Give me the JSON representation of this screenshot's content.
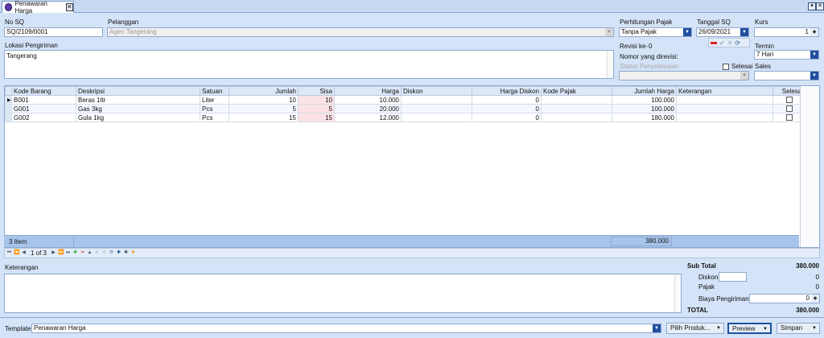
{
  "tab": {
    "title": "Penawaran Harga"
  },
  "header": {
    "no_sq": {
      "label": "No SQ",
      "value": "SQ/2109/0001"
    },
    "pelanggan": {
      "label": "Pelanggan",
      "placeholder": "Agen Tangerang"
    },
    "perhitungan_pajak": {
      "label": "Perhitungan Pajak",
      "value": "Tanpa Pajak"
    },
    "tanggal_sq": {
      "label": "Tanggal SQ",
      "value": "26/09/2021"
    },
    "kurs": {
      "label": "Kurs",
      "value": "1"
    },
    "lokasi": {
      "label": "Lokasi Pengiriman",
      "value": "Tangerang"
    },
    "revisi": {
      "label": "Revisi ke-",
      "value": "0"
    },
    "nomor_direvisi": {
      "label": "Nomor yang direvisi:"
    },
    "status_penyelesaian": {
      "label": "Status Penyelesaian"
    },
    "selesai": {
      "label": "Selesai"
    },
    "termin": {
      "label": "Termin",
      "value": "7 Hari"
    },
    "sales": {
      "label": "Sales",
      "value": ""
    }
  },
  "grid": {
    "columns": [
      "Kode Barang",
      "Deskripsi",
      "Satuan",
      "Jumlah",
      "Sisa",
      "Harga",
      "Diskon",
      "Harga Diskon",
      "Kode Pajak",
      "Jumlah Harga",
      "Keterangan",
      "Selesai"
    ],
    "rows": [
      {
        "kode": "B001",
        "deskripsi": "Beras 1ltr",
        "satuan": "Liter",
        "jumlah": "10",
        "sisa": "10",
        "harga": "10.000",
        "diskon": "",
        "harga_diskon": "0",
        "kode_pajak": "",
        "jumlah_harga": "100.000",
        "keterangan": ""
      },
      {
        "kode": "G001",
        "deskripsi": "Gas 3kg",
        "satuan": "Pcs",
        "jumlah": "5",
        "sisa": "5",
        "harga": "20.000",
        "diskon": "",
        "harga_diskon": "0",
        "kode_pajak": "",
        "jumlah_harga": "100.000",
        "keterangan": ""
      },
      {
        "kode": "G002",
        "deskripsi": "Gula 1kg",
        "satuan": "Pcs",
        "jumlah": "15",
        "sisa": "15",
        "harga": "12.000",
        "diskon": "",
        "harga_diskon": "0",
        "kode_pajak": "",
        "jumlah_harga": "180.000",
        "keterangan": ""
      }
    ],
    "footer_count": "3 Item",
    "footer_total": "380.000",
    "pager": "1 of 3"
  },
  "keterangan": {
    "label": "Keterangan",
    "value": ""
  },
  "summary": {
    "sub_total_label": "Sub Total",
    "sub_total": "380.000",
    "diskon_label": "Diskon",
    "diskon": "0",
    "pajak_label": "Pajak",
    "pajak": "0",
    "biaya_label": "Biaya Pengiriman",
    "biaya": "0",
    "total_label": "TOTAL",
    "total": "380.000"
  },
  "bottom": {
    "template_label": "Template",
    "template_value": "Penawaran Harga",
    "pilih_produk": "Pilih Produk...",
    "preview": "Preview",
    "simpan": "Simpan"
  }
}
